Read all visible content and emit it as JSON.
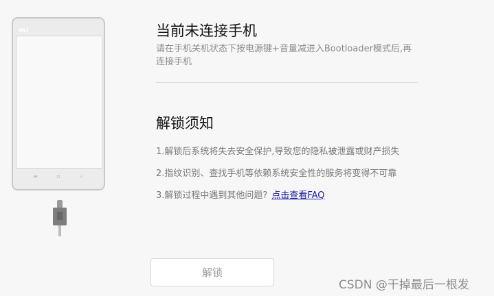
{
  "phone": {
    "logo": "mi",
    "nav_keys": [
      "≡",
      "▫",
      "‹"
    ]
  },
  "header": {
    "title": "当前未连接手机",
    "description": "请在手机关机状态下按电源键+音量减进入Bootloader模式后,再连接手机"
  },
  "notice": {
    "title": "解锁须知",
    "items": [
      "1.解锁后系统将失去安全保护,导致您的隐私被泄露或财产损失",
      "2.指纹识别、查找手机等依赖系统安全性的服务将变得不可靠",
      "3.解锁过程中遇到其他问题?"
    ],
    "faq_link": "点击查看FAQ"
  },
  "actions": {
    "unlock_label": "解锁"
  },
  "watermark": "CSDN @干掉最后一根发"
}
